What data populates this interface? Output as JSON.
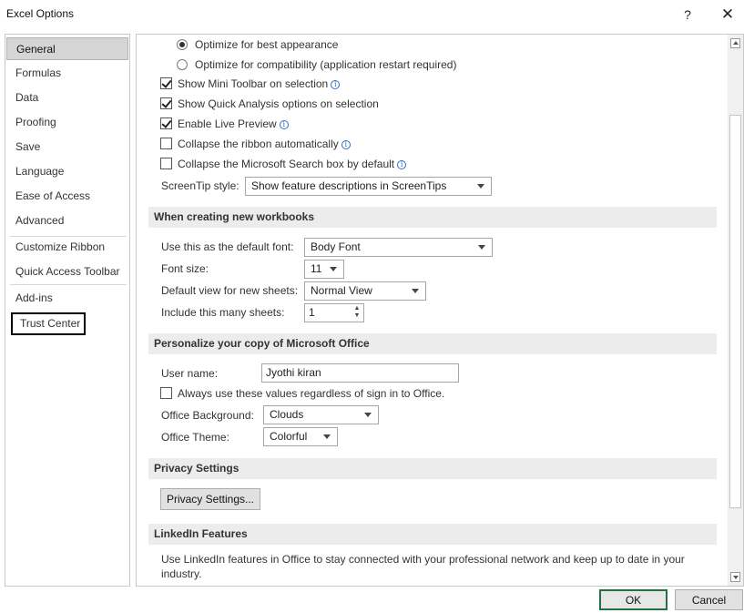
{
  "window": {
    "title": "Excel Options",
    "help_glyph": "?",
    "close_glyph": "✕"
  },
  "sidebar": {
    "items": [
      {
        "label": "General"
      },
      {
        "label": "Formulas"
      },
      {
        "label": "Data"
      },
      {
        "label": "Proofing"
      },
      {
        "label": "Save"
      },
      {
        "label": "Language"
      },
      {
        "label": "Ease of Access"
      },
      {
        "label": "Advanced"
      },
      {
        "label": "Customize Ribbon"
      },
      {
        "label": "Quick Access Toolbar"
      },
      {
        "label": "Add-ins"
      },
      {
        "label": "Trust Center"
      }
    ],
    "selected": "General"
  },
  "ui_options": {
    "radio_best_appearance": "Optimize for best appearance",
    "radio_compatibility": "Optimize for compatibility (application restart required)",
    "mini_toolbar": "Show Mini Toolbar on selection",
    "quick_analysis": "Show Quick Analysis options on selection",
    "live_preview": "Enable Live Preview",
    "collapse_ribbon": "Collapse the ribbon automatically",
    "collapse_search": "Collapse the Microsoft Search box by default",
    "screentip_label": "ScreenTip style:",
    "screentip_value": "Show feature descriptions in ScreenTips",
    "info_glyph": "i"
  },
  "new_workbooks": {
    "header": "When creating new workbooks",
    "font_label": "Use this as the default font:",
    "font_value": "Body Font",
    "size_label": "Font size:",
    "size_value": "11",
    "view_label": "Default view for new sheets:",
    "view_value": "Normal View",
    "sheets_label": "Include this many sheets:",
    "sheets_value": "1"
  },
  "personalize": {
    "header": "Personalize your copy of Microsoft Office",
    "username_label": "User name:",
    "username_value": "Jyothi kiran",
    "always_use": "Always use these values regardless of sign in to Office.",
    "background_label": "Office Background:",
    "background_value": "Clouds",
    "theme_label": "Office Theme:",
    "theme_value": "Colorful"
  },
  "privacy": {
    "header": "Privacy Settings",
    "button": "Privacy Settings..."
  },
  "linkedin": {
    "header": "LinkedIn Features",
    "description_line1": "Use LinkedIn features in Office to stay connected with your professional network and keep up to date in your",
    "description_line2": "industry."
  },
  "footer": {
    "ok": "OK",
    "cancel": "Cancel"
  }
}
